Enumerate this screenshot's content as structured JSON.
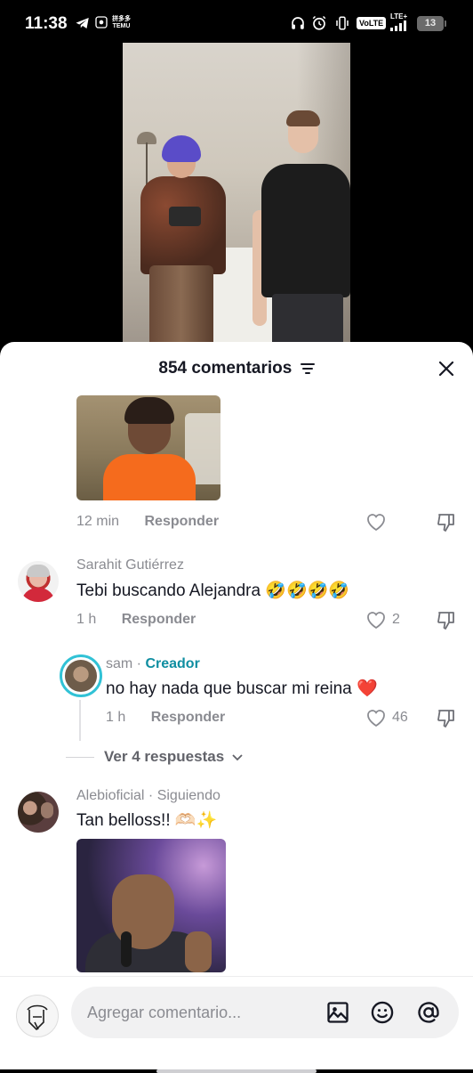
{
  "status_bar": {
    "time": "11:38",
    "temu_label": "拼多多\nTEMU",
    "volte": "VoLTE",
    "lte": "LTE+",
    "battery": "13"
  },
  "sheet": {
    "title": "854 comentarios",
    "close_icon": "close-icon",
    "filter_icon": "filter-icon"
  },
  "comments": [
    {
      "media": "reaction-image",
      "time": "12 min",
      "reply_label": "Responder",
      "like_count": ""
    },
    {
      "username": "Sarahit Gutiérrez",
      "text": "Tebi buscando Alejandra 🤣🤣🤣🤣",
      "time": "1 h",
      "reply_label": "Responder",
      "like_count": "2"
    },
    {
      "username": "sam",
      "username_sep": " · ",
      "creator_badge": "Creador",
      "text": "no hay nada que buscar mi reina ❤️",
      "time": "1 h",
      "reply_label": "Responder",
      "like_count": "46"
    },
    {
      "username": "Alebioficial · Siguiendo",
      "text": "Tan belloss!! 🫶🏻✨",
      "media": "reaction-image"
    }
  ],
  "view_replies": "Ver 4 respuestas",
  "composer": {
    "placeholder": "Agregar comentario...",
    "icons": [
      "image-icon",
      "emoji-icon",
      "mention-icon"
    ]
  },
  "colors": {
    "creator": "#0f8ea1",
    "avatar_ring": "#31c2d6",
    "heart_outline": "#8a8b91"
  }
}
